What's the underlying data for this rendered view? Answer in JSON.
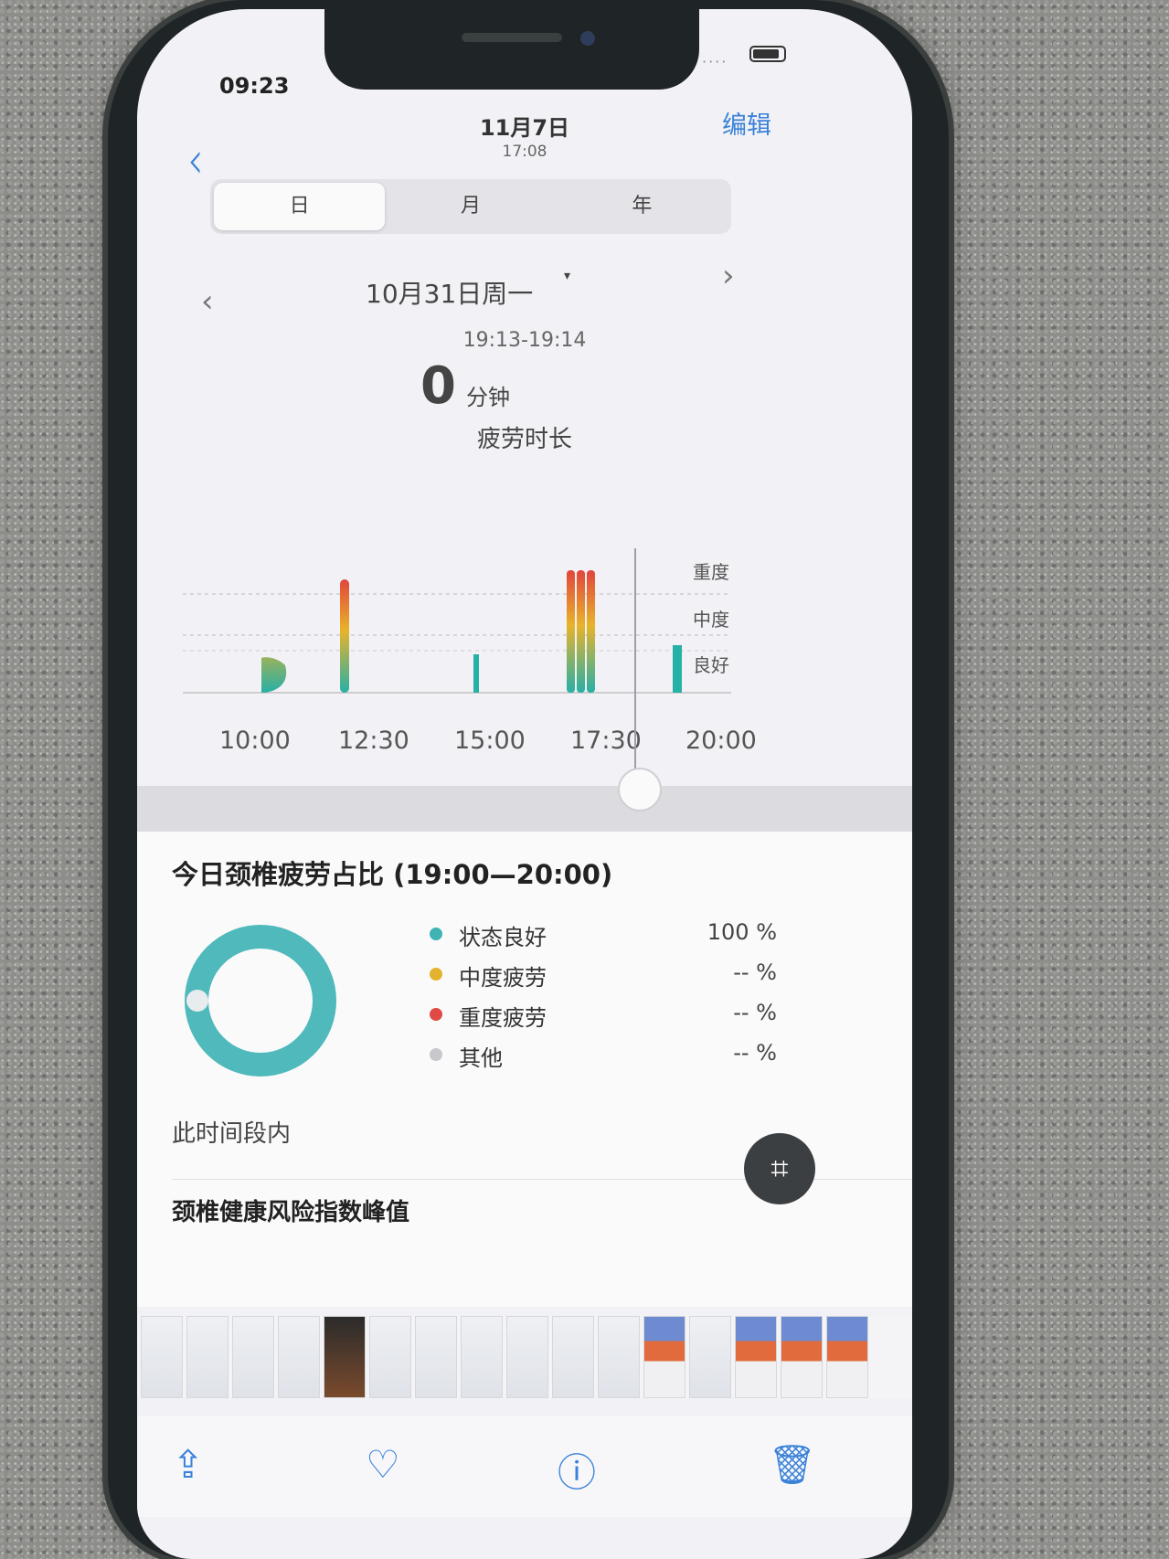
{
  "status_bar": {
    "time": "09:23",
    "signal": "····"
  },
  "nav": {
    "back": "‹",
    "date": "11月7日",
    "clock": "17:08",
    "edit": "编辑"
  },
  "segments": [
    "日",
    "月",
    "年"
  ],
  "day": {
    "prev": "‹",
    "next": "›",
    "label": "10月31日周一",
    "caret": "▾"
  },
  "summary": {
    "range": "19:13-19:14",
    "value": "0",
    "unit": "分钟",
    "metric": "疲劳时长"
  },
  "chart_data": {
    "type": "bar",
    "levels": [
      "重度",
      "中度",
      "良好"
    ],
    "x_ticks": [
      "10:00",
      "12:30",
      "15:00",
      "17:30",
      "20:00"
    ],
    "colors": {
      "good": "#27b0a6",
      "moderate": "#e8b32a",
      "severe": "#e2453c"
    }
  },
  "ratio_card": {
    "title": "今日颈椎疲劳占比 (19:00—20:00)",
    "rows": [
      {
        "label": "状态良好",
        "pct": "100 %",
        "color": "#3fb3b4"
      },
      {
        "label": "中度疲劳",
        "pct": "-- %",
        "color": "#e3b22e"
      },
      {
        "label": "重度疲劳",
        "pct": "-- %",
        "color": "#e04a44"
      },
      {
        "label": "其他",
        "pct": "-- %",
        "color": "#c8c8cc"
      }
    ],
    "footer": "此时间段内",
    "next_section": "颈椎健康风险指数峰值"
  },
  "toolbar": {
    "share": "⇪",
    "like": "♡",
    "info": "ⓘ",
    "delete": "🗑"
  },
  "scan_icon": "⌗"
}
